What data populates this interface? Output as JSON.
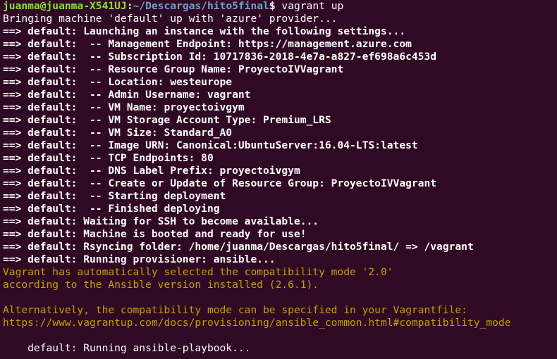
{
  "prompt": {
    "user_host": "juanma@juanma-X541UJ",
    "separator": ":",
    "path": "~/Descargas/hito5final",
    "symbol": "$",
    "command": " vagrant up"
  },
  "output_lines": [
    {
      "text": "Bringing machine 'default' up with 'azure' provider...",
      "style": "normal"
    },
    {
      "text": "==> default: Launching an instance with the following settings...",
      "style": "bold"
    },
    {
      "text": "==> default:  -- Management Endpoint: https://management.azure.com",
      "style": "bold"
    },
    {
      "text": "==> default:  -- Subscription Id: 10717836-2018-4e7a-a827-ef698a6c453d",
      "style": "bold"
    },
    {
      "text": "==> default:  -- Resource Group Name: ProyectoIVVagrant",
      "style": "bold"
    },
    {
      "text": "==> default:  -- Location: westeurope",
      "style": "bold"
    },
    {
      "text": "==> default:  -- Admin Username: vagrant",
      "style": "bold"
    },
    {
      "text": "==> default:  -- VM Name: proyectoivgym",
      "style": "bold"
    },
    {
      "text": "==> default:  -- VM Storage Account Type: Premium_LRS",
      "style": "bold"
    },
    {
      "text": "==> default:  -- VM Size: Standard_A0",
      "style": "bold"
    },
    {
      "text": "==> default:  -- Image URN: Canonical:UbuntuServer:16.04-LTS:latest",
      "style": "bold"
    },
    {
      "text": "==> default:  -- TCP Endpoints: 80",
      "style": "bold"
    },
    {
      "text": "==> default:  -- DNS Label Prefix: proyectoivgym",
      "style": "bold"
    },
    {
      "text": "==> default:  -- Create or Update of Resource Group: ProyectoIVVagrant",
      "style": "bold"
    },
    {
      "text": "==> default:  -- Starting deployment",
      "style": "bold"
    },
    {
      "text": "==> default:  -- Finished deploying",
      "style": "bold"
    },
    {
      "text": "==> default: Waiting for SSH to become available...",
      "style": "bold"
    },
    {
      "text": "==> default: Machine is booted and ready for use!",
      "style": "bold"
    },
    {
      "text": "==> default: Rsyncing folder: /home/juanma/Descargas/hito5final/ => /vagrant",
      "style": "bold"
    },
    {
      "text": "==> default: Running provisioner: ansible...",
      "style": "bold"
    },
    {
      "text": "Vagrant has automatically selected the compatibility mode '2.0'",
      "style": "warn"
    },
    {
      "text": "according to the Ansible version installed (2.6.1).",
      "style": "warn"
    },
    {
      "text": "",
      "style": "warn"
    },
    {
      "text": "Alternatively, the compatibility mode can be specified in your Vagrantfile:",
      "style": "warn"
    },
    {
      "text": "https://www.vagrantup.com/docs/provisioning/ansible_common.html#compatibility_mode",
      "style": "warn"
    },
    {
      "text": "",
      "style": "normal"
    },
    {
      "text": "    default: Running ansible-playbook...",
      "style": "normal"
    }
  ],
  "colors": {
    "background": "#300a24",
    "prompt_user": "#8ae234",
    "prompt_path": "#729fcf",
    "text": "#ffffff",
    "warning": "#c4a000"
  }
}
